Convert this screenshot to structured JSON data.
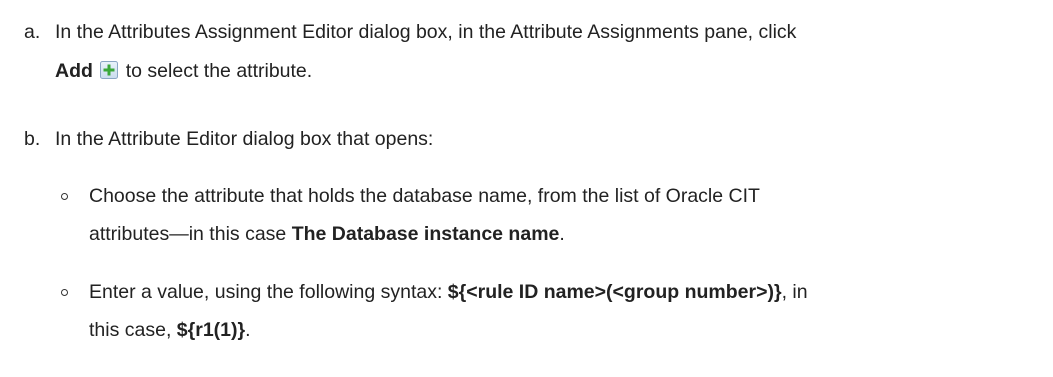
{
  "steps": {
    "a": {
      "marker": "a.",
      "line1": "In the Attributes Assignment Editor dialog box, in the Attribute Assignments pane, click",
      "add_label": "Add",
      "add_icon": "add-icon",
      "line2_rest": "to select the attribute."
    },
    "b": {
      "marker": "b.",
      "line1": "In the Attribute Editor dialog box that opens:",
      "bullets": [
        {
          "line1": "Choose the attribute that holds the database name, from the list of Oracle CIT",
          "line2_pre": "attributes—in this case ",
          "line2_bold": "The Database instance name",
          "line2_post": "."
        },
        {
          "line1_pre": "Enter a value, using the following syntax: ",
          "line1_bold": "${<rule ID name>(<group number>)}",
          "line1_post": ", in",
          "line2_pre": "this case, ",
          "line2_bold": "${r1(1)}",
          "line2_post": "."
        }
      ]
    }
  }
}
